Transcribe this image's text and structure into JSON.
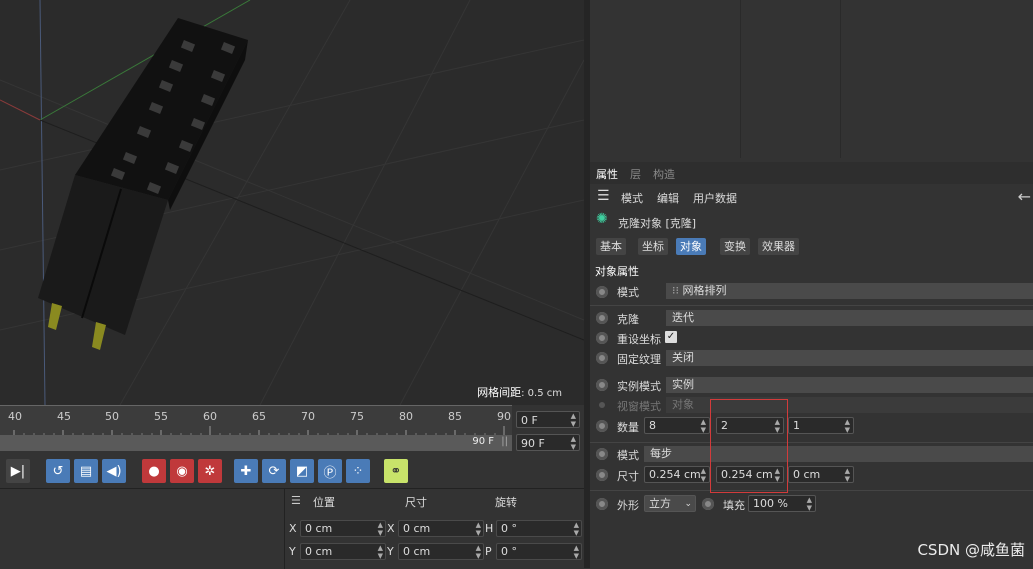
{
  "viewport": {
    "grid_spacing_label": "网格间距",
    "grid_spacing_value": ": 0.5 cm"
  },
  "timeline": {
    "ticks": [
      "40",
      "45",
      "50",
      "55",
      "60",
      "65",
      "70",
      "75",
      "80",
      "85",
      "90"
    ],
    "current_frame": "0 F",
    "end_frame_scrub": "90 F",
    "end_frame": "90 F"
  },
  "toolbar": {
    "icons": [
      "play-end-icon",
      "loop-icon",
      "film-icon",
      "sound-icon",
      "keyframe-icon",
      "record-icon",
      "autokey-icon",
      "move-key-icon",
      "rotate-key-icon",
      "scale-key-icon",
      "param-key-icon",
      "pla-key-icon",
      "onion-icon"
    ]
  },
  "coords": {
    "headers": {
      "position": "位置",
      "size": "尺寸",
      "rotation": "旋转"
    },
    "rows": [
      {
        "axis": "X",
        "pos": "0 cm",
        "size_axis": "X",
        "size": "0 cm",
        "rot_axis": "H",
        "rot": "0 °"
      },
      {
        "axis": "Y",
        "pos": "0 cm",
        "size_axis": "Y",
        "size": "0 cm",
        "rot_axis": "P",
        "rot": "0 °"
      }
    ]
  },
  "attr": {
    "tabs": [
      "属性",
      "层",
      "构造"
    ],
    "menu": [
      "模式",
      "编辑",
      "用户数据"
    ],
    "object_title": "克隆对象 [克隆]",
    "pills": [
      "基本",
      "坐标",
      "对象",
      "变换",
      "效果器"
    ],
    "active_pill": "对象",
    "section_title": "对象属性",
    "mode_label": "模式",
    "mode_value": "网格排列",
    "clone_label": "克隆",
    "clone_value": "迭代",
    "reset_coords_label": "重设坐标",
    "fix_texture_label": "固定纹理",
    "fix_texture_value": "关闭",
    "instance_mode_label": "实例模式",
    "instance_mode_value": "实例",
    "viewport_mode_label": "视窗模式",
    "viewport_mode_value": "对象",
    "count_label": "数量",
    "count": [
      "8",
      "2",
      "1"
    ],
    "mode2_label": "模式",
    "mode2_value": "每步",
    "size_label": "尺寸",
    "size": [
      "0.254 cm",
      "0.254 cm",
      "0 cm"
    ],
    "shape_label": "外形",
    "shape_value": "立方",
    "fill_label": "填充",
    "fill_value": "100 %"
  },
  "watermark": "CSDN @咸鱼菌",
  "colors": {
    "accent": "#4a7bb7",
    "highlight_box": "#d23b3b",
    "red_button": "#c0393b"
  }
}
